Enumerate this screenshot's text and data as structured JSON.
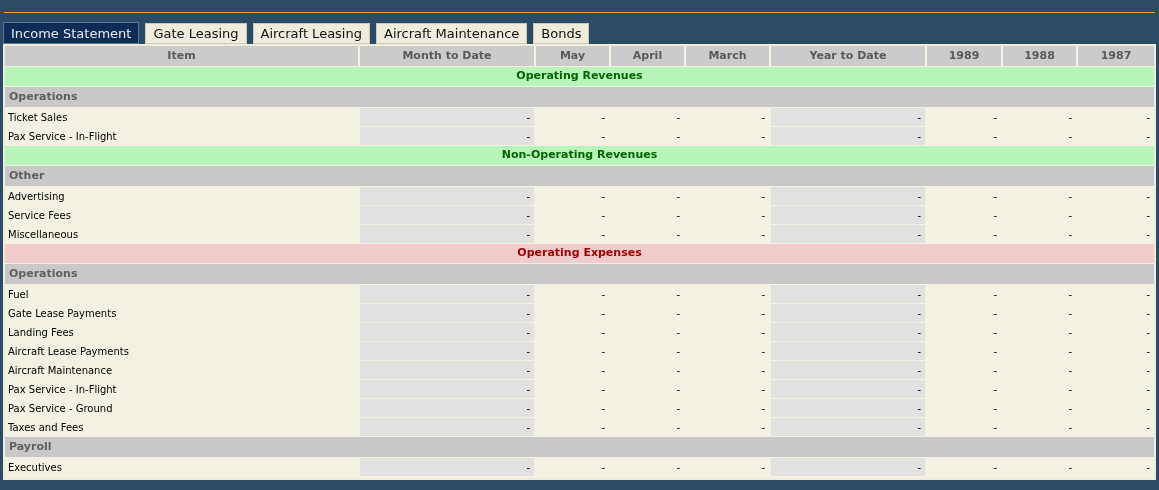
{
  "tabs": [
    {
      "label": "Income Statement",
      "selected": true
    },
    {
      "label": "Gate Leasing",
      "selected": false
    },
    {
      "label": "Aircraft Leasing",
      "selected": false
    },
    {
      "label": "Aircraft Maintenance",
      "selected": false
    },
    {
      "label": "Bonds",
      "selected": false
    }
  ],
  "table": {
    "columns": [
      "Item",
      "Month to Date",
      "May",
      "April",
      "March",
      "Year to Date",
      "1989",
      "1988",
      "1987"
    ],
    "rows": [
      {
        "kind": "revenue",
        "label": "Operating Revenues"
      },
      {
        "kind": "group",
        "label": "Operations"
      },
      {
        "kind": "data",
        "label": "Ticket Sales",
        "values": [
          "-",
          "-",
          "-",
          "-",
          "-",
          "-",
          "-",
          "-"
        ]
      },
      {
        "kind": "data",
        "label": "Pax Service - In-Flight",
        "values": [
          "-",
          "-",
          "-",
          "-",
          "-",
          "-",
          "-",
          "-"
        ]
      },
      {
        "kind": "revenue",
        "label": "Non-Operating Revenues"
      },
      {
        "kind": "group",
        "label": "Other"
      },
      {
        "kind": "data",
        "label": "Advertising",
        "values": [
          "-",
          "-",
          "-",
          "-",
          "-",
          "-",
          "-",
          "-"
        ]
      },
      {
        "kind": "data",
        "label": "Service Fees",
        "values": [
          "-",
          "-",
          "-",
          "-",
          "-",
          "-",
          "-",
          "-"
        ]
      },
      {
        "kind": "data",
        "label": "Miscellaneous",
        "values": [
          "-",
          "-",
          "-",
          "-",
          "-",
          "-",
          "-",
          "-"
        ]
      },
      {
        "kind": "expense",
        "label": "Operating Expenses"
      },
      {
        "kind": "group",
        "label": "Operations"
      },
      {
        "kind": "data",
        "label": "Fuel",
        "values": [
          "-",
          "-",
          "-",
          "-",
          "-",
          "-",
          "-",
          "-"
        ]
      },
      {
        "kind": "data",
        "label": "Gate Lease Payments",
        "values": [
          "-",
          "-",
          "-",
          "-",
          "-",
          "-",
          "-",
          "-"
        ]
      },
      {
        "kind": "data",
        "label": "Landing Fees",
        "values": [
          "-",
          "-",
          "-",
          "-",
          "-",
          "-",
          "-",
          "-"
        ]
      },
      {
        "kind": "data",
        "label": "Aircraft Lease Payments",
        "values": [
          "-",
          "-",
          "-",
          "-",
          "-",
          "-",
          "-",
          "-"
        ]
      },
      {
        "kind": "data",
        "label": "Aircraft Maintenance",
        "values": [
          "-",
          "-",
          "-",
          "-",
          "-",
          "-",
          "-",
          "-"
        ]
      },
      {
        "kind": "data",
        "label": "Pax Service - In-Flight",
        "values": [
          "-",
          "-",
          "-",
          "-",
          "-",
          "-",
          "-",
          "-"
        ]
      },
      {
        "kind": "data",
        "label": "Pax Service - Ground",
        "values": [
          "-",
          "-",
          "-",
          "-",
          "-",
          "-",
          "-",
          "-"
        ]
      },
      {
        "kind": "data",
        "label": "Taxes and Fees",
        "values": [
          "-",
          "-",
          "-",
          "-",
          "-",
          "-",
          "-",
          "-"
        ]
      },
      {
        "kind": "group",
        "label": "Payroll"
      },
      {
        "kind": "data",
        "label": "Executives",
        "values": [
          "-",
          "-",
          "-",
          "-",
          "-",
          "-",
          "-",
          "-"
        ]
      }
    ]
  }
}
